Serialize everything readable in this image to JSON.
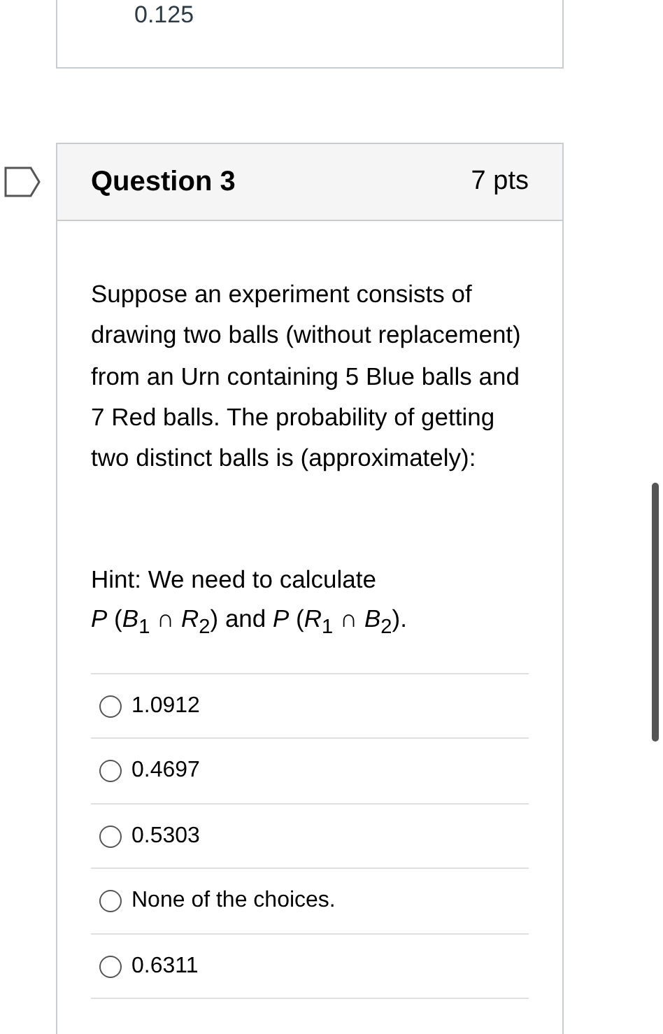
{
  "previous_question": {
    "answer_text": "0.125"
  },
  "question": {
    "title": "Question 3",
    "points": "7 pts",
    "prompt": "Suppose an experiment consists of drawing two balls (without replacement) from an Urn containing 5 Blue balls and 7 Red balls. The probability of getting two distinct balls is (approximately):",
    "hint": "Hint: We need to calculate",
    "formula": "*P* (*B*$_{1}$ ∩ *R*$_{2}$) and *P* (*R*$_{1}$ ∩ *B*$_{2}$).",
    "answers": [
      {
        "label": "1.0912",
        "selected": false
      },
      {
        "label": "0.4697",
        "selected": false
      },
      {
        "label": "0.5303",
        "selected": false
      },
      {
        "label": "None of the choices.",
        "selected": false
      },
      {
        "label": "0.6311",
        "selected": false
      }
    ]
  }
}
